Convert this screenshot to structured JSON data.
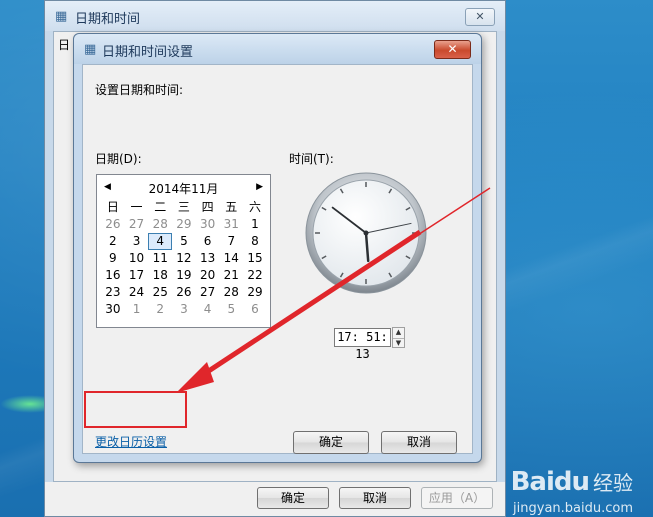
{
  "parent_window": {
    "title": "日期和时间",
    "close_label": "✕",
    "edge_text": "日",
    "buttons": {
      "ok": "确定",
      "cancel": "取消",
      "apply": "应用（A）"
    }
  },
  "dialog": {
    "title": "日期和时间设置",
    "close_label": "✕",
    "heading": "设置日期和时间:",
    "date_label": "日期(D):",
    "time_label": "时间(T):",
    "change_calendar_link": "更改日历设置",
    "ok_label": "确定",
    "cancel_label": "取消"
  },
  "calendar": {
    "month_label": "2014年11月",
    "prev_label": "◀",
    "next_label": "▶",
    "weekdays": [
      "日",
      "一",
      "二",
      "三",
      "四",
      "五",
      "六"
    ],
    "weeks": [
      [
        {
          "d": "26",
          "o": true
        },
        {
          "d": "27",
          "o": true
        },
        {
          "d": "28",
          "o": true
        },
        {
          "d": "29",
          "o": true
        },
        {
          "d": "30",
          "o": true
        },
        {
          "d": "31",
          "o": true
        },
        {
          "d": "1"
        }
      ],
      [
        {
          "d": "2"
        },
        {
          "d": "3"
        },
        {
          "d": "4",
          "selected": true
        },
        {
          "d": "5"
        },
        {
          "d": "6"
        },
        {
          "d": "7"
        },
        {
          "d": "8"
        }
      ],
      [
        {
          "d": "9"
        },
        {
          "d": "10"
        },
        {
          "d": "11"
        },
        {
          "d": "12"
        },
        {
          "d": "13"
        },
        {
          "d": "14"
        },
        {
          "d": "15"
        }
      ],
      [
        {
          "d": "16"
        },
        {
          "d": "17"
        },
        {
          "d": "18"
        },
        {
          "d": "19"
        },
        {
          "d": "20"
        },
        {
          "d": "21"
        },
        {
          "d": "22"
        }
      ],
      [
        {
          "d": "23"
        },
        {
          "d": "24"
        },
        {
          "d": "25"
        },
        {
          "d": "26"
        },
        {
          "d": "27"
        },
        {
          "d": "28"
        },
        {
          "d": "29"
        }
      ],
      [
        {
          "d": "30"
        },
        {
          "d": "1",
          "o": true
        },
        {
          "d": "2",
          "o": true
        },
        {
          "d": "3",
          "o": true
        },
        {
          "d": "4",
          "o": true
        },
        {
          "d": "5",
          "o": true
        },
        {
          "d": "6",
          "o": true
        }
      ]
    ]
  },
  "clock": {
    "hour": 17,
    "minute": 51,
    "second": 13
  },
  "time_field": {
    "value": "17: 51: 13",
    "up": "▲",
    "down": "▼"
  },
  "watermark": {
    "logo": "Baidu",
    "text": "经验",
    "url": "jingyan.baidu.com"
  },
  "colors": {
    "annotation": "#e0262b",
    "link": "#0b60a8"
  }
}
